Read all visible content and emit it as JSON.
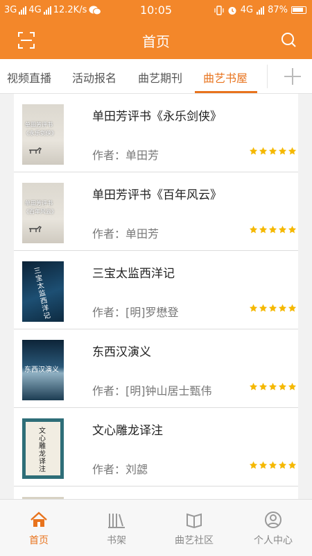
{
  "status_bar": {
    "network1": "3G",
    "network2": "4G",
    "speed": "12.2K/s",
    "time": "10:05",
    "network3": "4G",
    "battery": "87%"
  },
  "header": {
    "title": "首页",
    "icons": [
      "scan-icon",
      "search-icon"
    ]
  },
  "tabs": [
    {
      "label": "视频直播"
    },
    {
      "label": "活动报名"
    },
    {
      "label": "曲艺期刊"
    },
    {
      "label": "曲艺书屋"
    }
  ],
  "active_tab": "曲艺书屋",
  "books": [
    {
      "title": "单田芳评书《永乐剑侠》",
      "author": "作者：单田芳",
      "rating": 5,
      "cover_text": [
        "单田芳评书",
        "《永乐剑侠》"
      ]
    },
    {
      "title": "单田芳评书《百年风云》",
      "author": "作者：单田芳",
      "rating": 5,
      "cover_text": [
        "单田芳评书",
        "《百年风云》"
      ]
    },
    {
      "title": "三宝太监西洋记",
      "author": "作者：[明]罗懋登",
      "rating": 5,
      "cover_text": [
        "三宝太监西洋记"
      ]
    },
    {
      "title": "东西汉演义",
      "author": "作者：[明]钟山居士甄伟",
      "rating": 5,
      "cover_text": [
        "东西汉演义"
      ]
    },
    {
      "title": "文心雕龙译注",
      "author": "作者：刘勰",
      "rating": 5,
      "cover_text": [
        "文心雕龙译注"
      ]
    }
  ],
  "bottom_nav": [
    {
      "label": "首页",
      "icon": "home-icon"
    },
    {
      "label": "书架",
      "icon": "bookshelf-icon"
    },
    {
      "label": "曲艺社区",
      "icon": "community-icon"
    },
    {
      "label": "个人中心",
      "icon": "user-icon"
    }
  ],
  "colors": {
    "accent": "#f3872a",
    "active": "#e8731d",
    "star": "#f5b800"
  }
}
